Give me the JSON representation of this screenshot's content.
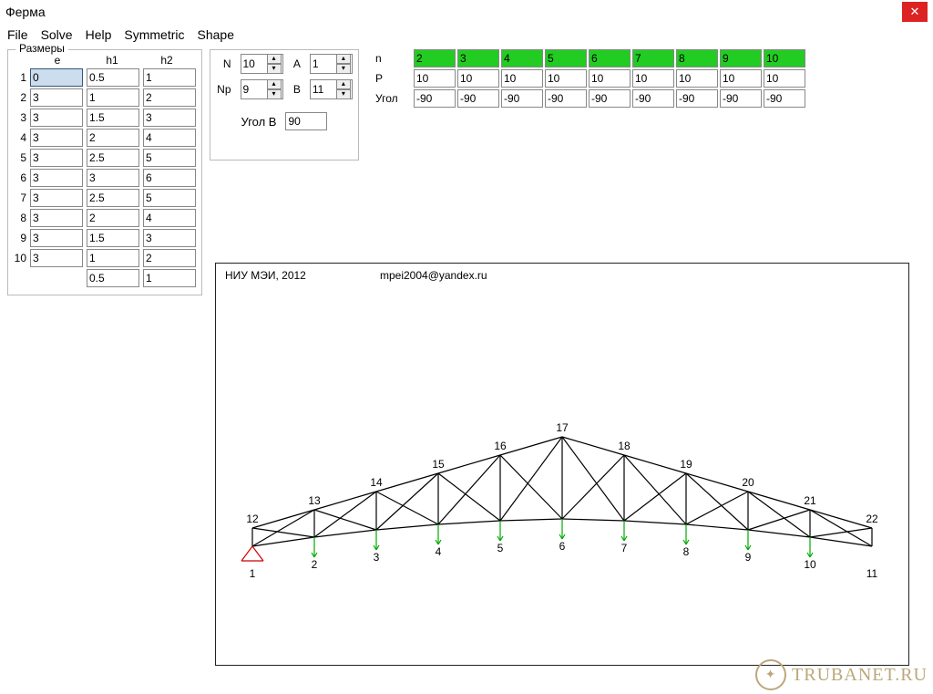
{
  "window": {
    "title": "Ферма"
  },
  "menu": [
    "File",
    "Solve",
    "Help",
    "Symmetric",
    "Shape"
  ],
  "sizes": {
    "legend": "Размеры",
    "headers": [
      "e",
      "h1",
      "h2"
    ],
    "rows": [
      {
        "n": "1",
        "e": "0",
        "h1": "0.5",
        "h2": "1"
      },
      {
        "n": "2",
        "e": "3",
        "h1": "1",
        "h2": "2"
      },
      {
        "n": "3",
        "e": "3",
        "h1": "1.5",
        "h2": "3"
      },
      {
        "n": "4",
        "e": "3",
        "h1": "2",
        "h2": "4"
      },
      {
        "n": "5",
        "e": "3",
        "h1": "2.5",
        "h2": "5"
      },
      {
        "n": "6",
        "e": "3",
        "h1": "3",
        "h2": "6"
      },
      {
        "n": "7",
        "e": "3",
        "h1": "2.5",
        "h2": "5"
      },
      {
        "n": "8",
        "e": "3",
        "h1": "2",
        "h2": "4"
      },
      {
        "n": "9",
        "e": "3",
        "h1": "1.5",
        "h2": "3"
      },
      {
        "n": "10",
        "e": "3",
        "h1": "1",
        "h2": "2"
      },
      {
        "n": "",
        "e": "",
        "h1": "0.5",
        "h2": "1"
      }
    ]
  },
  "params": {
    "N_label": "N",
    "N": "10",
    "Np_label": "Np",
    "Np": "9",
    "A_label": "A",
    "A": "1",
    "B_label": "B",
    "B": "11",
    "angleB_label": "Угол B",
    "angleB": "90"
  },
  "loads": {
    "rows": [
      {
        "label": "n",
        "cells": [
          "2",
          "3",
          "4",
          "5",
          "6",
          "7",
          "8",
          "9",
          "10"
        ],
        "green": true
      },
      {
        "label": "P",
        "cells": [
          "10",
          "10",
          "10",
          "10",
          "10",
          "10",
          "10",
          "10",
          "10"
        ],
        "green": false
      },
      {
        "label": "Угол",
        "cells": [
          "-90",
          "-90",
          "-90",
          "-90",
          "-90",
          "-90",
          "-90",
          "-90",
          "-90"
        ],
        "green": false
      }
    ]
  },
  "canvas": {
    "credit": "НИУ МЭИ, 2012",
    "email": "mpei2004@yandex.ru",
    "top_nodes": [
      "12",
      "13",
      "14",
      "15",
      "16",
      "17",
      "18",
      "19",
      "20",
      "21",
      "22"
    ],
    "bottom_nodes": [
      "1",
      "2",
      "3",
      "4",
      "5",
      "6",
      "7",
      "8",
      "9",
      "10",
      "11"
    ]
  },
  "watermark": "TRUBANET.RU"
}
